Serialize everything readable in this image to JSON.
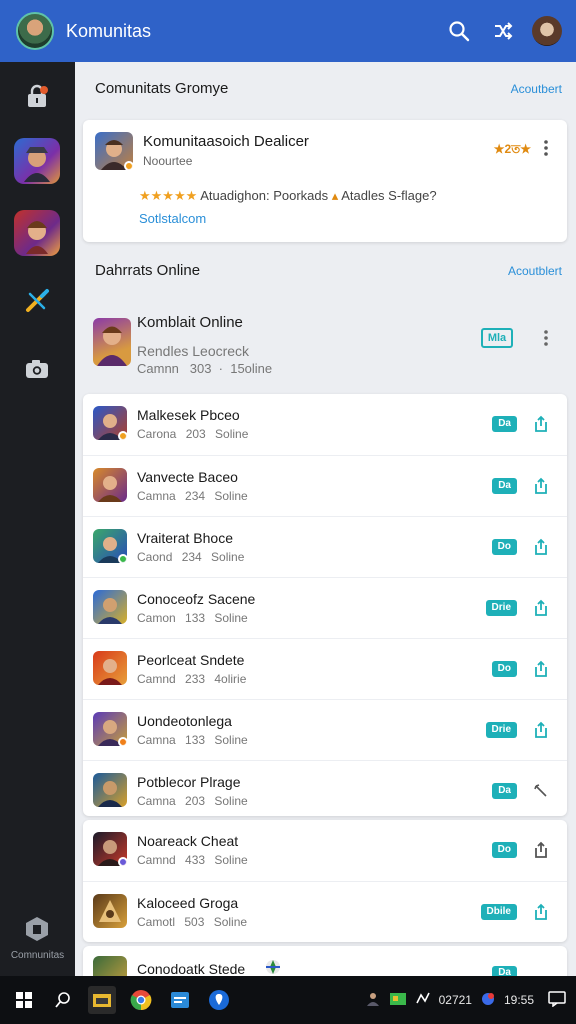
{
  "app": {
    "title": "Komunitas"
  },
  "sidebar": {
    "label": "Comnunitas"
  },
  "section1": {
    "title": "Comunitats Gromye",
    "action": "Acoutbert",
    "featured": {
      "name": "Komunitaasoich Dealicer",
      "subtitle": "Noourtee",
      "rating": "★2ত★",
      "stars": "★★★★★",
      "description": "Atuadighon: Poorkads",
      "description2": "Atadles S-flage?",
      "link": "Sotlstalcom"
    }
  },
  "section2": {
    "title": "Dahrrats Online",
    "action": "Acoutblert",
    "header_item": {
      "name": "Komblait Online",
      "desc": "Rendles Leocreck",
      "meta": "Camnn   303  ·  15oline",
      "tag": "Mla"
    }
  },
  "list": [
    {
      "name": "Malkesek Pbceo",
      "meta": "Carona 203 Soline",
      "tag": "Da"
    },
    {
      "name": "Vanvecte Baceo",
      "meta": "Camna 234 Soline",
      "tag": "Da"
    },
    {
      "name": "Vraiterat Bhoce",
      "meta": "Caond 234 Soline",
      "tag": "Do"
    },
    {
      "name": "Conoceofz Sacene",
      "meta": "Camon 133 Soline",
      "tag": "Drie"
    },
    {
      "name": "Peorlceat Sndete",
      "meta": "Camnd 233 4olirie",
      "tag": "Do"
    },
    {
      "name": "Uondeotonlega",
      "meta": "Camna 133 Soline",
      "tag": "Drie"
    },
    {
      "name": "Potblecor Plrage",
      "meta": "Camna 203 Soline",
      "tag": "Da"
    }
  ],
  "list2": [
    {
      "name": "Noareack Cheat",
      "meta": "Camnd 433 Soline",
      "tag": "Do"
    },
    {
      "name": "Kaloceed Groga",
      "meta": "Camotl 503 Soline",
      "tag": "Dbile"
    }
  ],
  "partial": {
    "name": "Conodoatk Stede",
    "tag": "Da"
  },
  "taskbar": {
    "time": "19:55",
    "date": "02721"
  },
  "colors": {
    "appbar": "#2f62c8",
    "accent": "#1eb0b8",
    "sidebar": "#1c1e22"
  }
}
